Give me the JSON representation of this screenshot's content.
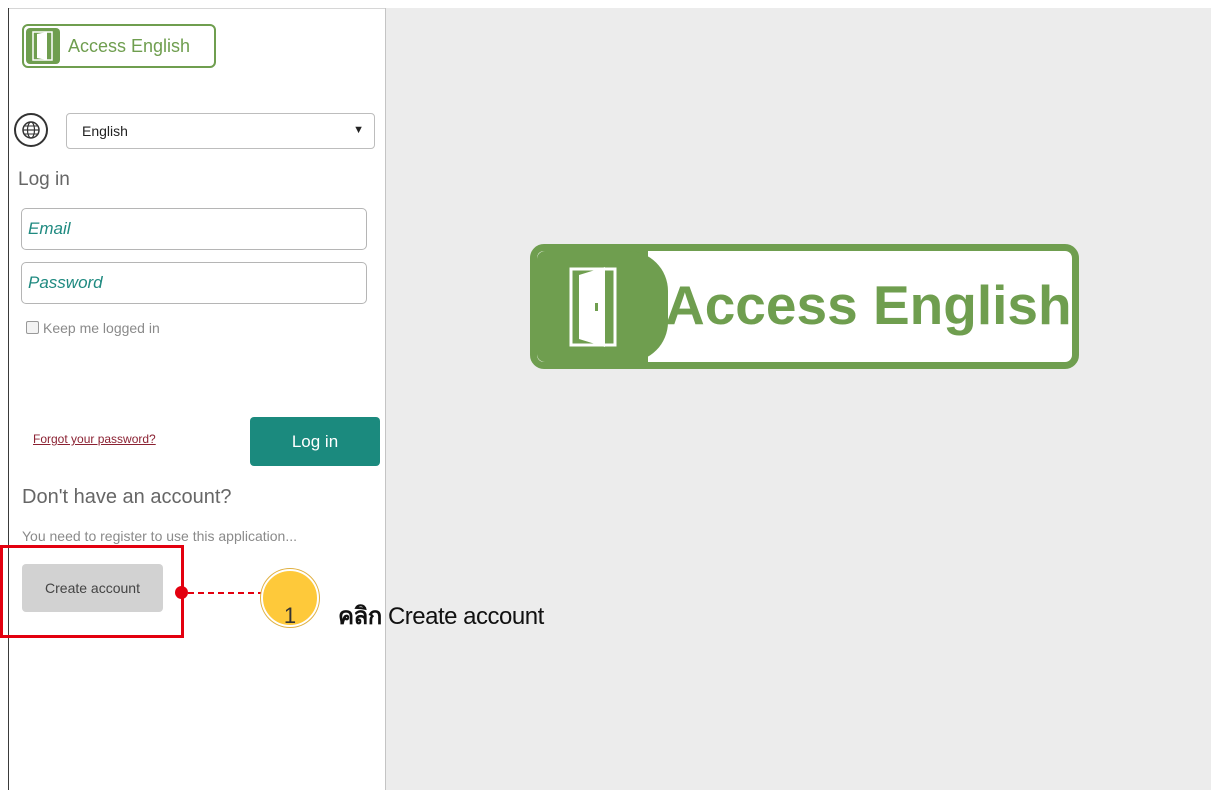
{
  "app": {
    "logo_text": "Access English"
  },
  "language": {
    "selected": "English"
  },
  "login": {
    "heading": "Log in",
    "email_placeholder": "Email",
    "password_placeholder": "Password",
    "keep_logged_in": "Keep me logged in",
    "forgot_link": "Forgot your password?",
    "login_button": "Log in"
  },
  "register": {
    "heading": "Don't have an account?",
    "message": "You need to register to use this application...",
    "create_button": "Create account"
  },
  "annotation": {
    "step_number": "1",
    "step_verb": "คลิก",
    "step_target": "Create account"
  },
  "colors": {
    "brand_green": "#6f9e4f",
    "teal_button": "#1b8a7e",
    "annotation_red": "#e3000f",
    "badge_yellow": "#fec93a"
  },
  "icons": {
    "globe": "globe-icon",
    "door": "door-icon",
    "dropdown": "chevron-down-icon",
    "checkbox": "checkbox-icon"
  }
}
